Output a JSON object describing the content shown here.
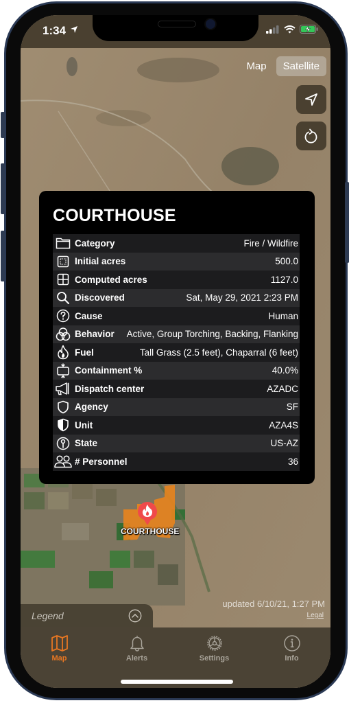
{
  "status_bar": {
    "time": "1:34"
  },
  "map": {
    "toggle": [
      {
        "label": "Map",
        "active": false
      },
      {
        "label": "Satellite",
        "active": true
      }
    ],
    "controls": [
      {
        "icon": "location-arrow-icon"
      },
      {
        "icon": "refresh-icon"
      }
    ],
    "marker_label": "COURTHOUSE",
    "updated_text": "updated 6/10/21, 1:27 PM",
    "legal_label": "Legal",
    "accent_color": "#e87722",
    "marker_color": "#f04a4a"
  },
  "card": {
    "title": "COURTHOUSE",
    "rows": [
      {
        "icon": "folder-icon",
        "label": "Category",
        "value": "Fire / Wildfire"
      },
      {
        "icon": "initial-acres-icon",
        "label": "Initial acres",
        "value": "500.0"
      },
      {
        "icon": "grid-icon",
        "label": "Computed acres",
        "value": "1127.0"
      },
      {
        "icon": "search-icon",
        "label": "Discovered",
        "value": "Sat, May 29, 2021 2:23 PM"
      },
      {
        "icon": "question-icon",
        "label": "Cause",
        "value": "Human"
      },
      {
        "icon": "behavior-circles-icon",
        "label": "Behavior",
        "value": "Active, Group Torching, Backing, Flanking"
      },
      {
        "icon": "flame-icon",
        "label": "Fuel",
        "value": "Tall Grass (2.5 feet), Chaparral (6 feet)"
      },
      {
        "icon": "containment-icon",
        "label": "Containment %",
        "value": "40.0%"
      },
      {
        "icon": "megaphone-icon",
        "label": "Dispatch center",
        "value": "AZADC"
      },
      {
        "icon": "shield-icon",
        "label": "Agency",
        "value": "SF"
      },
      {
        "icon": "half-shield-icon",
        "label": "Unit",
        "value": "AZA4S"
      },
      {
        "icon": "pin-icon",
        "label": "State",
        "value": "US-AZ"
      },
      {
        "icon": "people-icon",
        "label": "# Personnel",
        "value": "36"
      }
    ]
  },
  "legend": {
    "label": "Legend"
  },
  "tabs": [
    {
      "label": "Map",
      "active": true
    },
    {
      "label": "Alerts",
      "active": false
    },
    {
      "label": "Settings",
      "active": false
    },
    {
      "label": "Info",
      "active": false
    }
  ]
}
